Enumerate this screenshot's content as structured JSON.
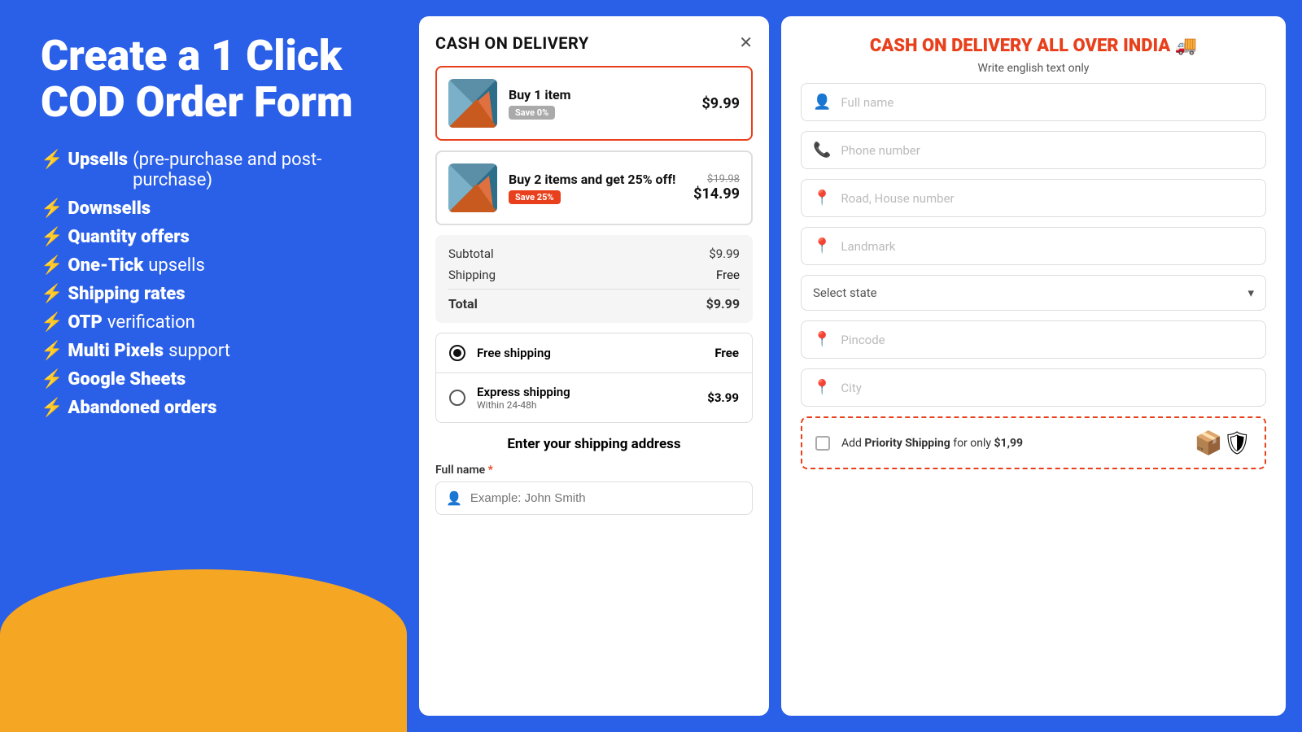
{
  "left": {
    "title": "Create a 1 Click COD Order Form",
    "features": [
      {
        "bolt": "⚡",
        "highlight": "Upsells",
        "normal": "(pre-purchase and post-purchase)"
      },
      {
        "bolt": "⚡",
        "highlight": "Downsells",
        "normal": ""
      },
      {
        "bolt": "⚡",
        "highlight": "Quantity offers",
        "normal": ""
      },
      {
        "bolt": "⚡",
        "highlight": "One-Tick",
        "normal": "upsells"
      },
      {
        "bolt": "⚡",
        "highlight": "Shipping rates",
        "normal": ""
      },
      {
        "bolt": "⚡",
        "highlight": "OTP",
        "normal": "verification"
      },
      {
        "bolt": "⚡",
        "highlight": "Multi Pixels",
        "normal": "support"
      },
      {
        "bolt": "⚡",
        "highlight": "Google Sheets",
        "normal": ""
      },
      {
        "bolt": "⚡",
        "highlight": "Abandoned orders",
        "normal": ""
      }
    ]
  },
  "middle": {
    "header": {
      "title": "CASH ON DELIVERY",
      "close": "✕"
    },
    "products": [
      {
        "id": "p1",
        "title": "Buy 1 item",
        "badge": "Save 0%",
        "badge_type": "gray",
        "price_original": "",
        "price": "$9.99",
        "selected": true
      },
      {
        "id": "p2",
        "title": "Buy 2 items and get 25% off!",
        "badge": "Save 25%",
        "badge_type": "orange",
        "price_original": "$19.98",
        "price": "$14.99",
        "selected": false
      }
    ],
    "summary": {
      "subtotal_label": "Subtotal",
      "subtotal_value": "$9.99",
      "shipping_label": "Shipping",
      "shipping_value": "Free",
      "total_label": "Total",
      "total_value": "$9.99"
    },
    "shipping_options": [
      {
        "id": "s1",
        "name": "Free shipping",
        "sub": "",
        "price": "Free",
        "checked": true
      },
      {
        "id": "s2",
        "name": "Express shipping",
        "sub": "Within 24-48h",
        "price": "$3.99",
        "checked": false
      }
    ],
    "address_section": {
      "heading": "Enter your shipping address",
      "field_label": "Full name",
      "field_required": true,
      "field_placeholder": "Example: John Smith"
    }
  },
  "right": {
    "title": "CASH ON DELIVERY ALL OVER INDIA 🚚",
    "subtitle": "Write english text only",
    "fields": [
      {
        "icon": "👤",
        "placeholder": "Full name"
      },
      {
        "icon": "📞",
        "placeholder": "Phone number"
      },
      {
        "icon": "📍",
        "placeholder": "Road, House number"
      },
      {
        "icon": "📍",
        "placeholder": "Landmark"
      }
    ],
    "select_state": {
      "label": "Select state",
      "arrow": "▾"
    },
    "fields2": [
      {
        "icon": "📍",
        "placeholder": "Pincode"
      },
      {
        "icon": "📍",
        "placeholder": "City"
      }
    ],
    "priority": {
      "text_before": "Add ",
      "bold": "Priority Shipping",
      "text_after": " for only ",
      "price": "$1,99",
      "icon": "📦"
    }
  }
}
